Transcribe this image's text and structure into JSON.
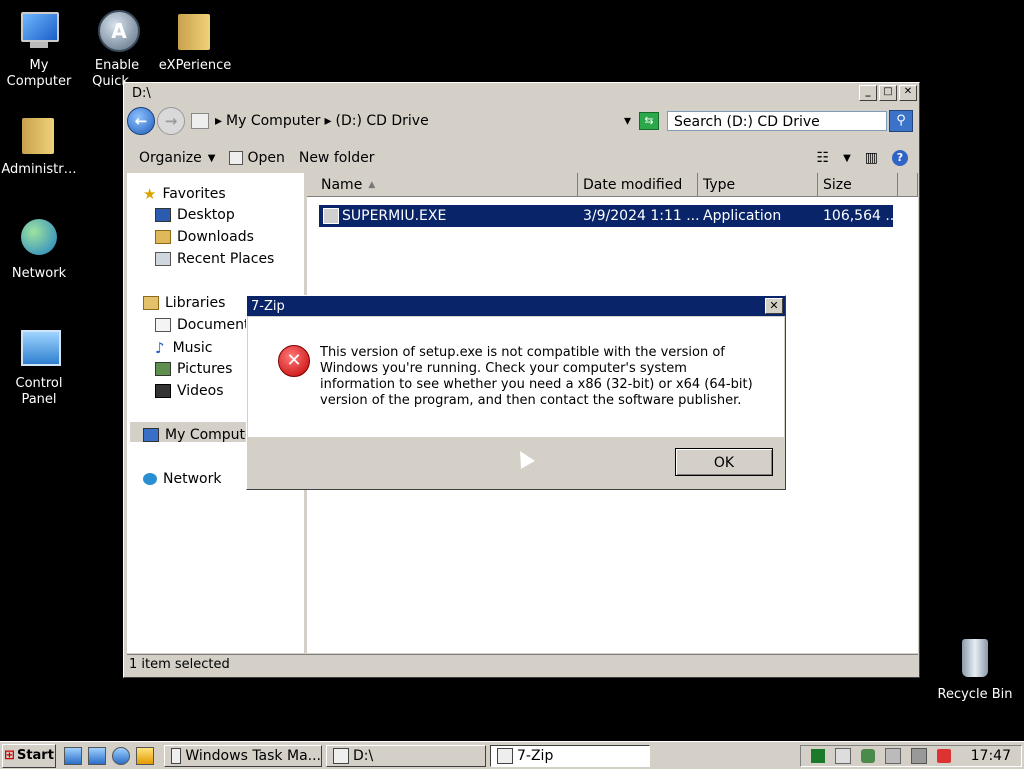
{
  "desktop": {
    "icons": [
      {
        "label": "My Computer",
        "icon": "computer-icon"
      },
      {
        "label": "Enable Quick…",
        "icon": "quicklaunch-icon"
      },
      {
        "label": "eXPerience",
        "icon": "folder-icon"
      },
      {
        "label": "Administr…",
        "icon": "user-folder-icon"
      },
      {
        "label": "Network",
        "icon": "network-icon"
      },
      {
        "label": "Control Panel",
        "icon": "control-panel-icon"
      },
      {
        "label": "Recycle Bin",
        "icon": "recycle-bin-icon"
      }
    ]
  },
  "explorer": {
    "title": "D:\\",
    "address": {
      "crumb1": "My Computer",
      "crumb2": "(D:) CD Drive"
    },
    "search_placeholder": "Search (D:) CD Drive",
    "toolbar": {
      "organize": "Organize",
      "open": "Open",
      "new_folder": "New folder"
    },
    "nav": {
      "favorites": "Favorites",
      "desktop": "Desktop",
      "downloads": "Downloads",
      "recent": "Recent Places",
      "libraries": "Libraries",
      "documents": "Documents",
      "music": "Music",
      "pictures": "Pictures",
      "videos": "Videos",
      "my_computer": "My Computer",
      "network": "Network"
    },
    "columns": {
      "name": "Name",
      "date": "Date modified",
      "type": "Type",
      "size": "Size"
    },
    "files": [
      {
        "name": "SUPERMIU.EXE",
        "date": "3/9/2024 1:11 ...",
        "type": "Application",
        "size": "106,564 ..."
      }
    ],
    "status": "1 item selected"
  },
  "dialog": {
    "title": "7-Zip",
    "message": "This version of setup.exe is not compatible with the version of Windows you're running. Check your computer's system information to see whether you need a x86 (32-bit) or x64 (64-bit) version of the program, and then contact the software publisher.",
    "ok_label": "OK"
  },
  "taskbar": {
    "start_label": "Start",
    "tasks": [
      {
        "label": "Windows Task Ma..."
      },
      {
        "label": "D:\\"
      },
      {
        "label": "7-Zip"
      }
    ],
    "clock": "17:47"
  }
}
